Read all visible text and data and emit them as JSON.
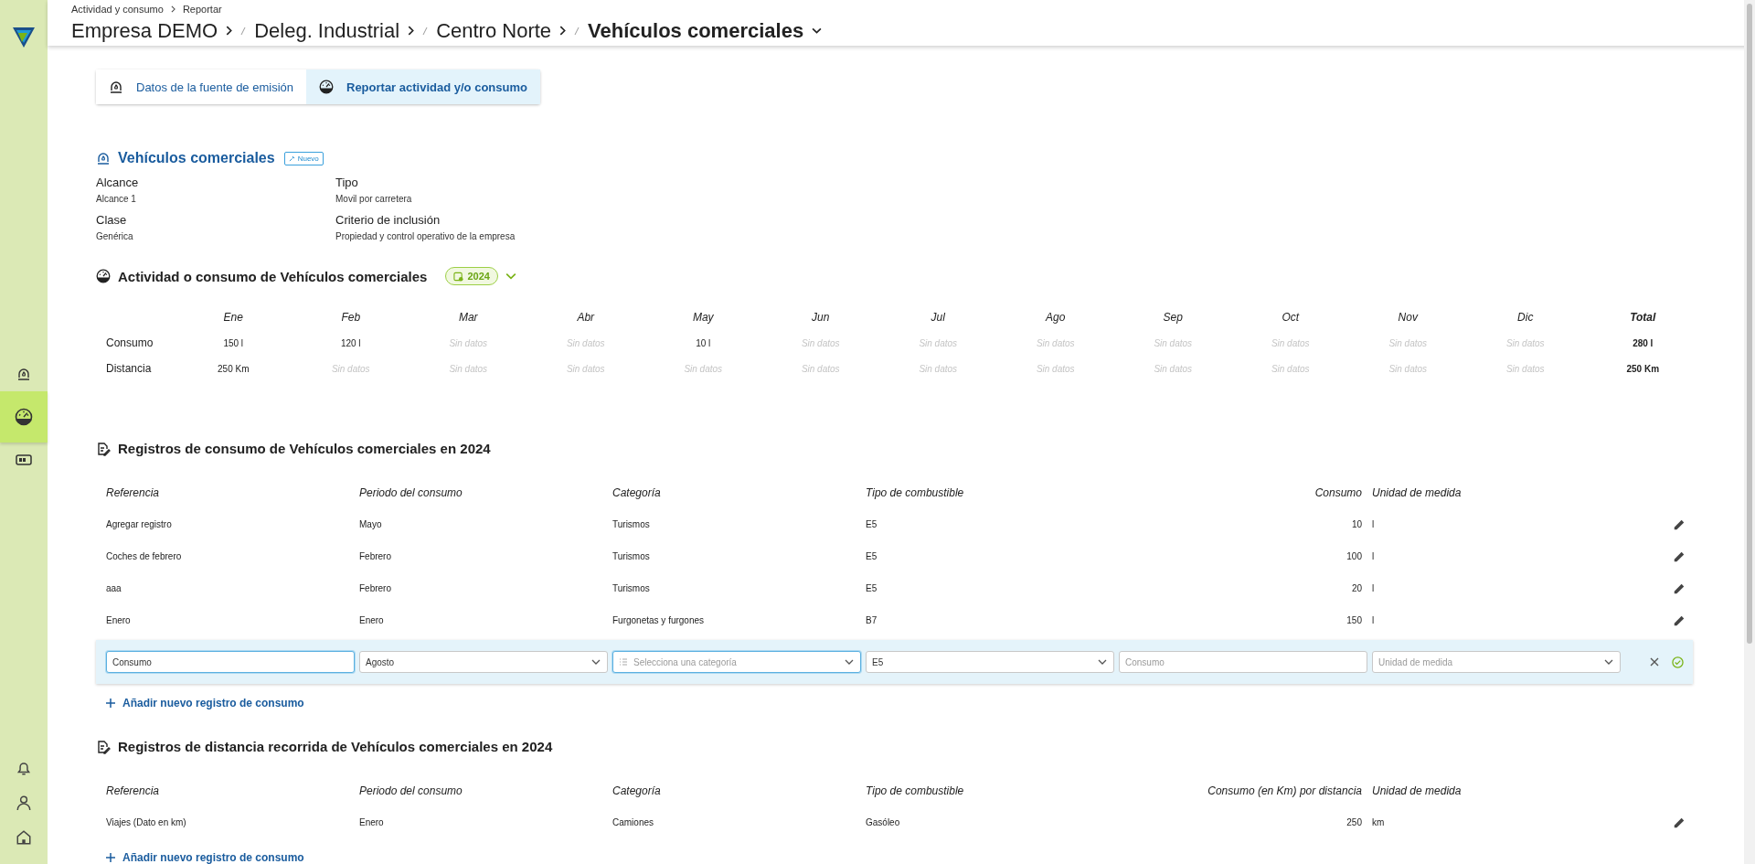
{
  "sidebar": {
    "items": [
      {
        "selected": false
      },
      {
        "selected": true
      },
      {
        "selected": false
      }
    ]
  },
  "breadcrumb": [
    "Actividad y consumo",
    "Reportar"
  ],
  "path": [
    {
      "label": "Empresa DEMO",
      "current": false
    },
    {
      "label": "Deleg. Industrial",
      "current": false
    },
    {
      "label": "Centro Norte",
      "current": false
    },
    {
      "label": "Vehículos comerciales",
      "current": true
    }
  ],
  "tabs": [
    {
      "label": "Datos de la fuente de emisión",
      "selected": false
    },
    {
      "label": "Reportar actividad y/o consumo",
      "selected": true
    }
  ],
  "source": {
    "title": "Vehículos comerciales",
    "badge": "Nuevo",
    "fields": [
      {
        "label": "Alcance",
        "value": "Alcance 1"
      },
      {
        "label": "Tipo",
        "value": "Movil por carretera"
      },
      {
        "label": "Clase",
        "value": "Genérica"
      },
      {
        "label": "Criterio de inclusión",
        "value": "Propiedad y control operativo de la empresa"
      }
    ]
  },
  "activity": {
    "title": "Actividad o consumo de Vehículos comerciales",
    "year": "2024",
    "columns": [
      "Ene",
      "Feb",
      "Mar",
      "Abr",
      "May",
      "Jun",
      "Jul",
      "Ago",
      "Sep",
      "Oct",
      "Nov",
      "Dic",
      "Total"
    ],
    "rows": [
      {
        "label": "Consumo",
        "cells": [
          {
            "text": "150 l",
            "empty": false
          },
          {
            "text": "120 l",
            "empty": false
          },
          {
            "text": "Sin datos",
            "empty": true
          },
          {
            "text": "Sin datos",
            "empty": true
          },
          {
            "text": "10 l",
            "empty": false
          },
          {
            "text": "Sin datos",
            "empty": true
          },
          {
            "text": "Sin datos",
            "empty": true
          },
          {
            "text": "Sin datos",
            "empty": true
          },
          {
            "text": "Sin datos",
            "empty": true
          },
          {
            "text": "Sin datos",
            "empty": true
          },
          {
            "text": "Sin datos",
            "empty": true
          },
          {
            "text": "Sin datos",
            "empty": true
          },
          {
            "text": "280 l",
            "empty": false
          }
        ]
      },
      {
        "label": "Distancia",
        "cells": [
          {
            "text": "250 Km",
            "empty": false
          },
          {
            "text": "Sin datos",
            "empty": true
          },
          {
            "text": "Sin datos",
            "empty": true
          },
          {
            "text": "Sin datos",
            "empty": true
          },
          {
            "text": "Sin datos",
            "empty": true
          },
          {
            "text": "Sin datos",
            "empty": true
          },
          {
            "text": "Sin datos",
            "empty": true
          },
          {
            "text": "Sin datos",
            "empty": true
          },
          {
            "text": "Sin datos",
            "empty": true
          },
          {
            "text": "Sin datos",
            "empty": true
          },
          {
            "text": "Sin datos",
            "empty": true
          },
          {
            "text": "Sin datos",
            "empty": true
          },
          {
            "text": "250 Km",
            "empty": false
          }
        ]
      }
    ]
  },
  "records": [
    {
      "title": "Registros de consumo de Vehículos comerciales en 2024",
      "columns": [
        "Referencia",
        "Periodo del consumo",
        "Categoría",
        "Tipo de combustible",
        "Consumo",
        "Unidad de medida"
      ],
      "rows": [
        {
          "cells": [
            "Agregar registro",
            "Mayo",
            "Turismos",
            "E5",
            "10",
            "l"
          ]
        },
        {
          "cells": [
            "Coches de febrero",
            "Febrero",
            "Turismos",
            "E5",
            "100",
            "l"
          ]
        },
        {
          "cells": [
            "aaa",
            "Febrero",
            "Turismos",
            "E5",
            "20",
            "l"
          ]
        },
        {
          "cells": [
            "Enero",
            "Enero",
            "Furgonetas y furgones",
            "B7",
            "150",
            "l"
          ]
        }
      ],
      "edit_row": [
        {
          "kind": "input",
          "value": "Consumo",
          "focused": true
        },
        {
          "kind": "select",
          "value": "Agosto",
          "focused": false
        },
        {
          "kind": "category",
          "placeholder": "Selecciona una categoría",
          "focused": true
        },
        {
          "kind": "select",
          "value": "E5",
          "focused": false
        },
        {
          "kind": "input",
          "placeholder": "Consumo",
          "focused": false
        },
        {
          "kind": "select",
          "placeholder": "Unidad de medida",
          "focused": false
        }
      ],
      "add_label": "Añadir nuevo registro de consumo"
    },
    {
      "title": "Registros de distancia recorrida de Vehículos comerciales en 2024",
      "columns": [
        "Referencia",
        "Periodo del consumo",
        "Categoría",
        "Tipo de combustible",
        "Consumo (en Km) por distancia",
        "Unidad de medida"
      ],
      "rows": [
        {
          "cells": [
            "Viajes (Dato en km)",
            "Enero",
            "Camiones",
            "Gasóleo",
            "250",
            "km"
          ]
        }
      ],
      "add_label": "Añadir nuevo registro de consumo"
    }
  ]
}
